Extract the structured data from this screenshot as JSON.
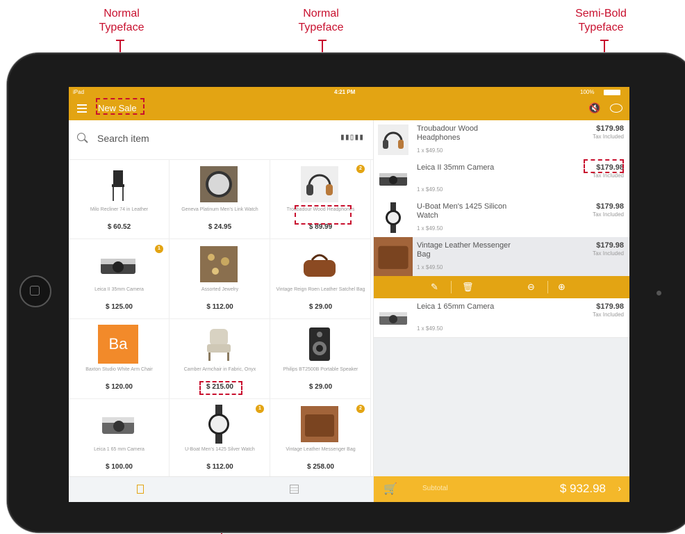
{
  "annotations": {
    "left": "Normal\nTypeface",
    "center": "Normal\nTypeface",
    "right": "Semi-Bold\nTypeface"
  },
  "status_bar": {
    "device": "iPad",
    "time": "4:21 PM",
    "battery": "100%"
  },
  "nav": {
    "title": "New Sale"
  },
  "search": {
    "placeholder": "Search item"
  },
  "products": [
    {
      "name": "Milo Recliner 74 in Leather",
      "price": "$ 60.52",
      "badge": ""
    },
    {
      "name": "Geneva Platinum Men's Link Watch",
      "price": "$ 24.95",
      "badge": ""
    },
    {
      "name": "Troubadour Wood Headphones",
      "price": "$ 89.99",
      "badge": "2"
    },
    {
      "name": "Leica II 35mm Camera",
      "price": "$ 125.00",
      "badge": "1"
    },
    {
      "name": "Assorted Jewelry",
      "price": "$ 112.00",
      "badge": ""
    },
    {
      "name": "Vintage Reign Roen Leather Satchel Bag",
      "price": "$ 29.00",
      "badge": ""
    },
    {
      "name": "Baxton Studio White Arm Chair",
      "price": "$ 120.00",
      "badge": ""
    },
    {
      "name": "Camber Armchair in Fabric, Onyx",
      "price": "$ 215.00",
      "badge": ""
    },
    {
      "name": "Philips BT2500B Portable Speaker",
      "price": "$ 29.00",
      "badge": ""
    },
    {
      "name": "Leica 1 65 mm Camera",
      "price": "$ 100.00",
      "badge": ""
    },
    {
      "name": "U-Boat Men's 1425 Silver Watch",
      "price": "$ 112.00",
      "badge": "1"
    },
    {
      "name": "Vintage Leather Messenger Bag",
      "price": "$ 258.00",
      "badge": "2"
    }
  ],
  "tile_text": "Ba",
  "cart": [
    {
      "name": "Troubadour Wood Headphones",
      "qty": "1 x $49.50",
      "amount": "$179.98",
      "tax": "Tax Included"
    },
    {
      "name": "Leica II 35mm Camera",
      "qty": "1 x $49.50",
      "amount": "$179.98",
      "tax": "Tax Included"
    },
    {
      "name": "U-Boat Men's 1425 Silicon Watch",
      "qty": "1 x $49.50",
      "amount": "$179.98",
      "tax": "Tax Included"
    },
    {
      "name": "Vintage Leather Messenger Bag",
      "qty": "1 x $49.50",
      "amount": "$179.98",
      "tax": "Tax Included"
    },
    {
      "name": "Leica 1 65mm Camera",
      "qty": "1 x $49.50",
      "amount": "$179.98",
      "tax": "Tax Included"
    }
  ],
  "footer": {
    "label": "Subtotal",
    "amount": "$ 932.98",
    "chevron": "›"
  },
  "colors": {
    "accent": "#e3a413",
    "footer": "#f4b82a",
    "annotation": "#c8102e"
  },
  "icons": [
    "menu-icon",
    "search-icon",
    "barcode-icon",
    "mute-icon",
    "chat-icon",
    "edit-icon",
    "trash-icon",
    "minus-icon",
    "plus-icon",
    "cart-icon"
  ]
}
